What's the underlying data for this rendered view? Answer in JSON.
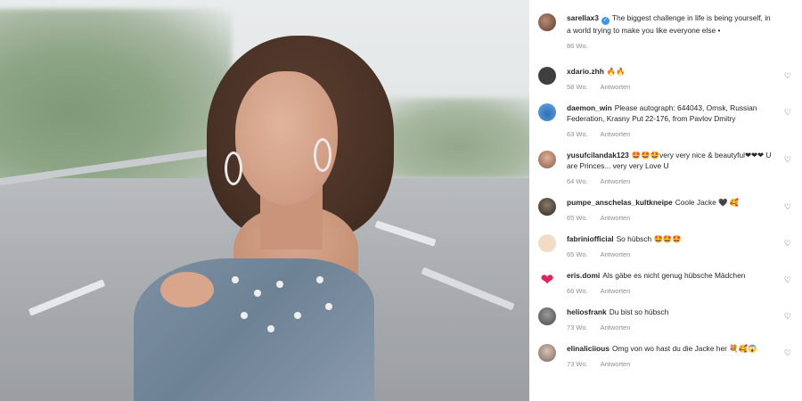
{
  "caption": {
    "user": "sarellax3",
    "text": "The biggest challenge in life is being yourself, in a world trying to make you like everyone else •",
    "time": "86 Wo."
  },
  "reply_label": "Antworten",
  "comments": [
    {
      "user": "xdario.zhh",
      "text": "🔥🔥",
      "time": "58 Wo."
    },
    {
      "user": "daemon_win",
      "text": "Please autograph: 644043, Omsk, Russian Federation, Krasny Put 22-176, from Pavlov Dmitry",
      "time": "63 Wo."
    },
    {
      "user": "yusufcilandak123",
      "text": "🤩🤩🤩very very nice & beautyful❤❤❤ U are Princes... very very Love U",
      "time": "64 Wo."
    },
    {
      "user": "pumpe_anschelas_kultkneipe",
      "text": "Coole Jacke 🖤 🥰",
      "time": "65 Wo."
    },
    {
      "user": "fabriniofficial",
      "text": "So hübsch 🤩🤩🤩",
      "time": "65 Wo."
    },
    {
      "user": "eris.domi",
      "text": "Als gäbe es nicht genug hübsche Mädchen",
      "time": "66 Wo."
    },
    {
      "user": "heliosfrank",
      "text": "Du bist so hübsch",
      "time": "73 Wo."
    },
    {
      "user": "elinaliciious",
      "text": "Omg von wo hast du die Jacke her 💐🥰😱",
      "time": "73 Wo."
    }
  ],
  "icons": {
    "heart": "heart-outline-icon",
    "verified": "verified-badge-icon"
  },
  "colors": {
    "verified": "#3897f0",
    "meta": "#8e8e8e"
  }
}
